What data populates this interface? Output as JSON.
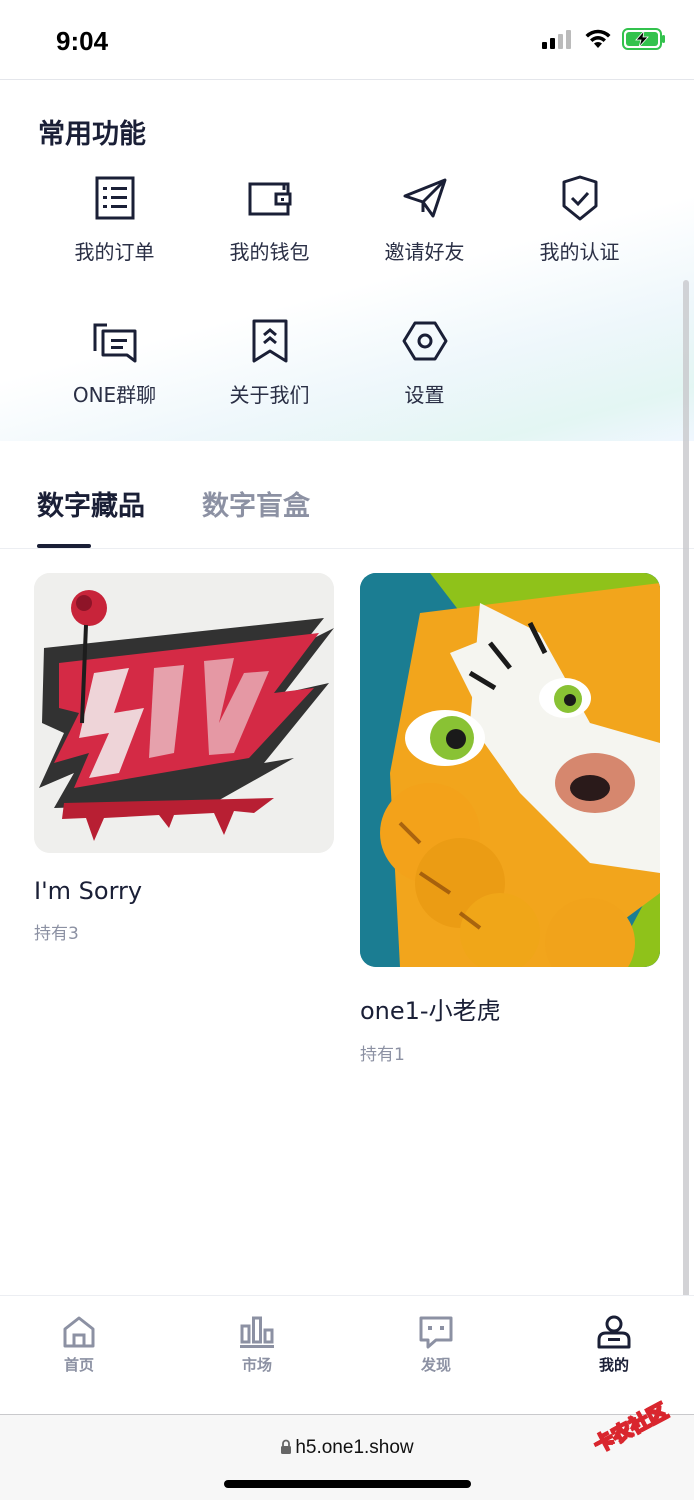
{
  "status_bar": {
    "time": "9:04"
  },
  "common_functions": {
    "title": "常用功能",
    "items": [
      {
        "label": "我的订单",
        "icon": "order-list-icon"
      },
      {
        "label": "我的钱包",
        "icon": "wallet-icon"
      },
      {
        "label": "邀请好友",
        "icon": "paper-plane-icon"
      },
      {
        "label": "我的认证",
        "icon": "shield-check-icon"
      },
      {
        "label": "ONE群聊",
        "icon": "group-chat-icon"
      },
      {
        "label": "关于我们",
        "icon": "bookmark-icon"
      },
      {
        "label": "设置",
        "icon": "hexagon-settings-icon"
      }
    ]
  },
  "tabs": {
    "active": "数字藏品",
    "inactive": "数字盲盒"
  },
  "collectibles": [
    {
      "name": "I'm Sorry",
      "holding": "持有3"
    },
    {
      "name": "one1-小老虎",
      "holding": "持有1"
    }
  ],
  "bottom_nav": [
    {
      "label": "首页",
      "icon": "home-icon",
      "active": false
    },
    {
      "label": "市场",
      "icon": "market-chart-icon",
      "active": false
    },
    {
      "label": "发现",
      "icon": "discover-chat-icon",
      "active": false
    },
    {
      "label": "我的",
      "icon": "profile-icon",
      "active": true
    }
  ],
  "browser": {
    "url": "h5.one1.show"
  },
  "watermark": "卡农社区",
  "colors": {
    "primary_text": "#1a1f36",
    "muted_text": "#8c91a3",
    "battery_green": "#33c24d"
  }
}
